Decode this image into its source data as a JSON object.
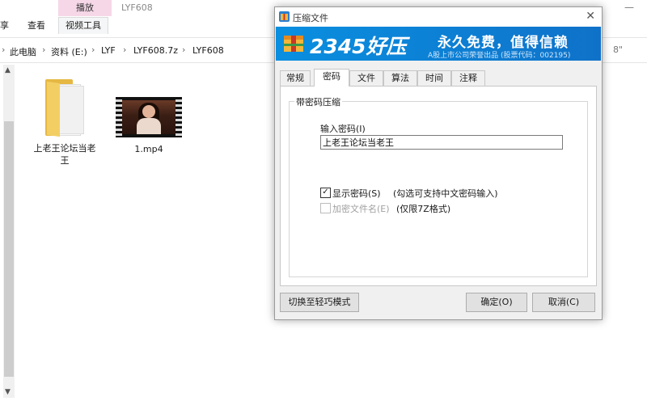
{
  "explorer": {
    "ribbon": {
      "context_tab_header": "播放",
      "tabs": [
        "享",
        "查看",
        "视频工具"
      ],
      "title": "LYF608"
    },
    "breadcrumb": [
      "此电脑",
      "资料 (E:)",
      "LYF",
      "LYF608.7z",
      "LYF608"
    ],
    "address_tail": "8\"",
    "files": [
      {
        "name": "上老王论坛当老王",
        "type": "folder"
      },
      {
        "name": "1.mp4",
        "type": "video"
      }
    ]
  },
  "dialog": {
    "title": "压缩文件",
    "banner": {
      "brand": "2345好压",
      "slogan": "永久免费，值得信赖",
      "subslogan": "A股上市公司荣誉出品 (股票代码：002195)"
    },
    "tabs": [
      {
        "label": "常规"
      },
      {
        "label": "密码"
      },
      {
        "label": "文件"
      },
      {
        "label": "算法"
      },
      {
        "label": "时间"
      },
      {
        "label": "注释"
      }
    ],
    "active_tab": "密码",
    "group_title": "带密码压缩",
    "password_label": "输入密码(I)",
    "password_value": "上老王论坛当老王",
    "show_password": {
      "label": "显示密码(S)",
      "checked": true,
      "hint": "(勾选可支持中文密码输入)"
    },
    "encrypt_filenames": {
      "label": "加密文件名(E)",
      "checked": false,
      "enabled": false,
      "hint": "(仅限7Z格式)"
    },
    "buttons": {
      "switch_mode": "切换至轻巧模式",
      "ok": "确定(O)",
      "cancel": "取消(C)"
    }
  },
  "colors": {
    "banner_blue": "#0a8fe0",
    "context_tab_pink": "#f6d7e8",
    "folder_yellow": "#e6b843"
  }
}
